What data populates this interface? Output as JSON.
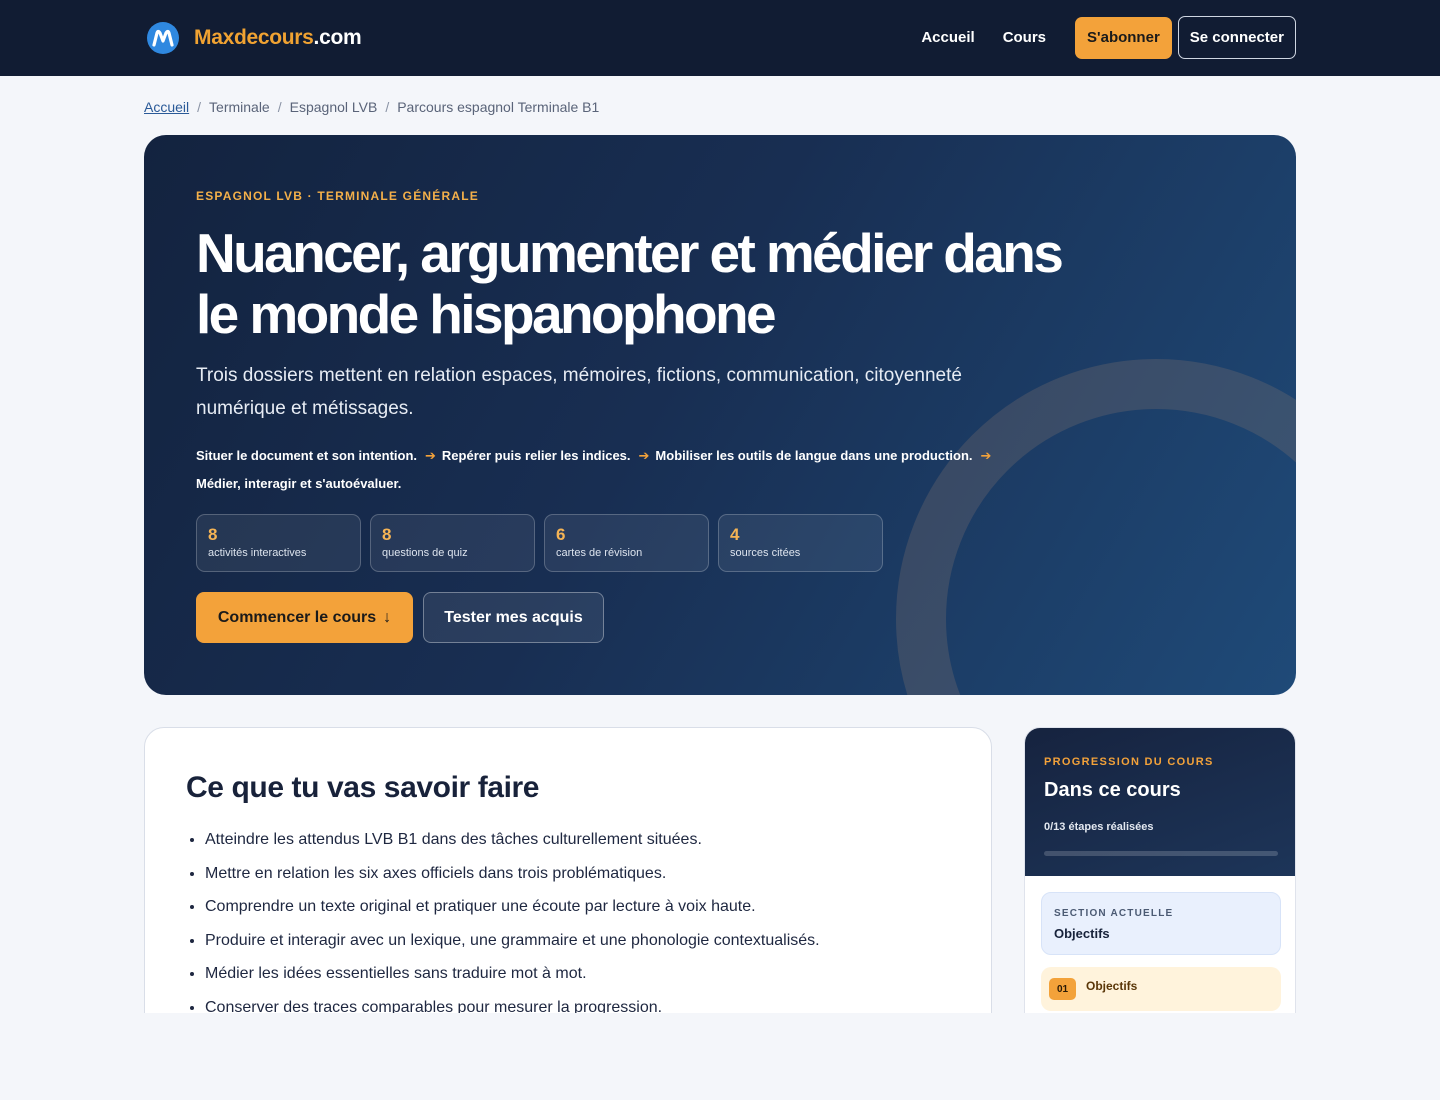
{
  "header": {
    "brand_main": "Maxdecours",
    "brand_tld": ".com",
    "nav": [
      {
        "label": "Accueil"
      },
      {
        "label": "Cours"
      }
    ],
    "subscribe_label": "S'abonner",
    "login_label": "Se connecter"
  },
  "breadcrumb": [
    "Accueil",
    "Terminale",
    "Espagnol LVB",
    "Parcours espagnol Terminale B1"
  ],
  "hero": {
    "kicker": "ESPAGNOL LVB · TERMINALE GÉNÉRALE",
    "title": "Nuancer, argumenter et médier dans le monde hispanophone",
    "subtitle": "Trois dossiers mettent en relation espaces, mémoires, fictions, communication, citoyenneté numérique et métissages.",
    "steps": [
      "Situer le document et son intention.",
      "Repérer puis relier les indices.",
      "Mobiliser les outils de langue dans une production.",
      "Médier, interagir et s'autoévaluer."
    ],
    "stats": [
      {
        "value": "8",
        "label": "activités interactives"
      },
      {
        "value": "8",
        "label": "questions de quiz"
      },
      {
        "value": "6",
        "label": "cartes de révision"
      },
      {
        "value": "4",
        "label": "sources citées"
      }
    ],
    "start_label": "Commencer le cours",
    "start_arrow": "↓",
    "test_label": "Tester mes acquis"
  },
  "objectives": {
    "title": "Ce que tu vas savoir faire",
    "items": [
      "Atteindre les attendus LVB B1 dans des tâches culturellement situées.",
      "Mettre en relation les six axes officiels dans trois problématiques.",
      "Comprendre un texte original et pratiquer une écoute par lecture à voix haute.",
      "Produire et interagir avec un lexique, une grammaire et une phonologie contextualisés.",
      "Médier les idées essentielles sans traduire mot à mot.",
      "Conserver des traces comparables pour mesurer la progression."
    ]
  },
  "progress": {
    "kicker": "PROGRESSION DU COURS",
    "title": "Dans ce cours",
    "count_text": "0/13 étapes réalisées",
    "fraction": 0,
    "current_kicker": "SECTION ACTUELLE",
    "current_name": "Objectifs",
    "steps": [
      {
        "num": "01",
        "label": "Objectifs"
      }
    ]
  },
  "colors": {
    "accent": "#f3a23a",
    "navy": "#111c33",
    "logo_blue": "#2f88e0"
  }
}
